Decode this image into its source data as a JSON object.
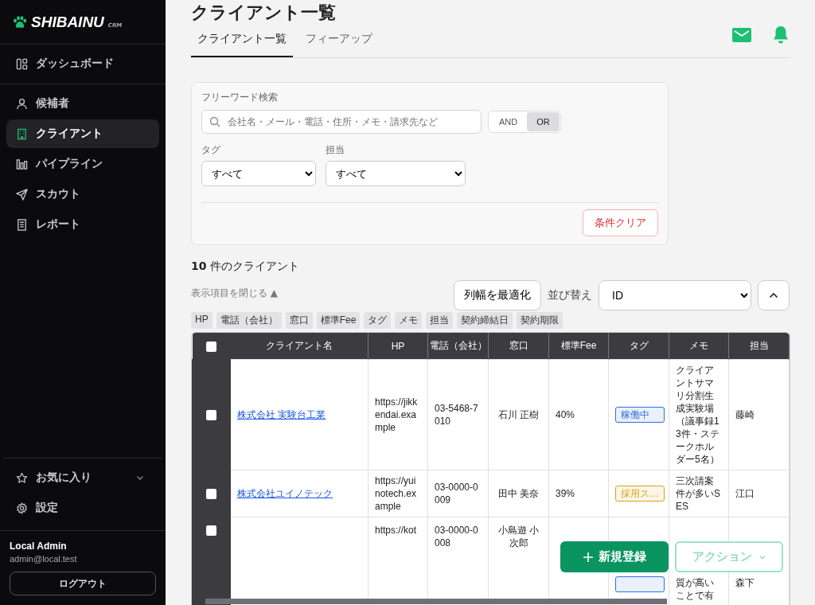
{
  "sidebar": {
    "logo": "SHIBAINU",
    "logo_sub": "CRM",
    "top_items": [
      {
        "label": "ダッシュボード",
        "selected": false
      }
    ],
    "items": [
      {
        "label": "候補者",
        "selected": false
      },
      {
        "label": "クライアント",
        "selected": true
      },
      {
        "label": "パイプライン",
        "selected": false
      },
      {
        "label": "スカウト",
        "selected": false
      },
      {
        "label": "レポート",
        "selected": false
      }
    ],
    "bottom_items": [
      {
        "label": "お気に入り",
        "kind": "expandable"
      },
      {
        "label": "設定",
        "kind": "plain"
      }
    ],
    "user": {
      "name": "Local Admin",
      "email": "admin@local.test",
      "logout": "ログアウト"
    }
  },
  "page": {
    "title": "クライアント一覧",
    "tabs": [
      {
        "label": "クライアント一覧",
        "selected": true
      },
      {
        "label": "フィーアップ",
        "selected": false
      }
    ]
  },
  "filters": {
    "search_label": "フリーワード検索",
    "search_placeholder": "会社名・メール・電話・住所・メモ・請求先など",
    "modes": [
      {
        "label": "AND",
        "selected": false
      },
      {
        "label": "OR",
        "selected": true
      }
    ],
    "selects": [
      {
        "label": "タグ",
        "value": "すべて"
      },
      {
        "label": "担当",
        "value": "すべて"
      }
    ],
    "clear": "条件クリア"
  },
  "result": {
    "count": "10",
    "count_text": "件のクライアント",
    "toggle_columns": "表示項目を閉じる ▲",
    "fit_columns": "列幅を最適化",
    "sort_label": "並び替え",
    "sort_value": "ID",
    "column_chips": [
      "HP",
      "電話（会社）",
      "窓口",
      "標準Fee",
      "タグ",
      "メモ",
      "担当",
      "契約締結日",
      "契約期限"
    ]
  },
  "table": {
    "columns": [
      "クライアント名",
      "HP",
      "電話（会社）",
      "窓口",
      "標準Fee",
      "タグ",
      "メモ",
      "担当"
    ],
    "all_checked": false,
    "rows": [
      {
        "checked": false,
        "name": "株式会社 実験台工業",
        "hp": "https://jikkendai.example",
        "phone": "03-5468-7010",
        "contact": "石川 正樹",
        "fee": "40%",
        "tag": {
          "label": "稼働中",
          "color": "#2f6fe0"
        },
        "memo": "クライアントサマリ分割生成実験場（議事録13件・ステークホルダー5名）",
        "owner": "藤崎"
      },
      {
        "checked": false,
        "name": "株式会社ユイノテック",
        "hp": "https://yuinotech.example",
        "phone": "03-0000-0009",
        "contact": "田中 美奈",
        "fee": "39%",
        "tag": {
          "label": "採用ス…",
          "color": "#d9a21b"
        },
        "memo": "三次請案件が多いSES",
        "owner": "江口"
      },
      {
        "checked": false,
        "hp": "https://kot",
        "phone": "03-0000-0008",
        "contact": "小島遊 小次郎",
        "tag": {
          "color": "#2f6fe0"
        },
        "memo": "質が高いことで有",
        "owner": "森下"
      }
    ]
  },
  "actions": {
    "create": "新規登録",
    "menu": "アクション"
  }
}
